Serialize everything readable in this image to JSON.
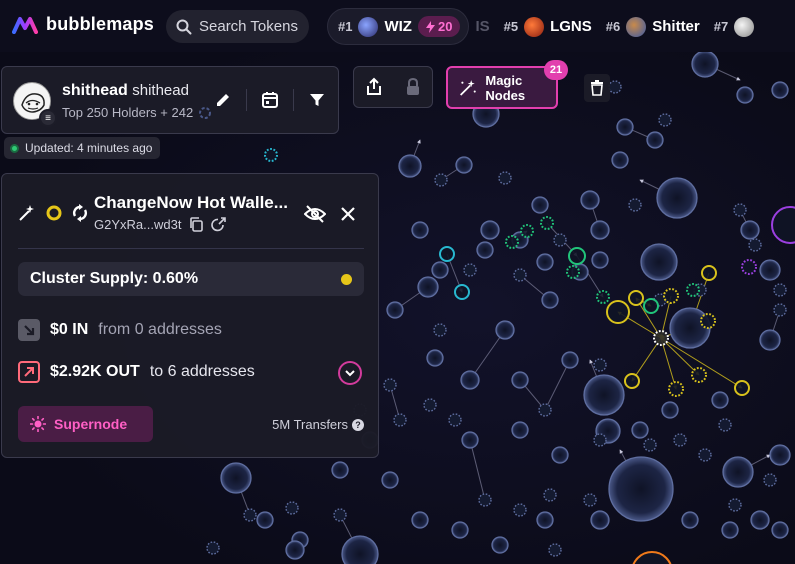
{
  "app": {
    "name": "bubblemaps"
  },
  "search": {
    "label": "Search Tokens"
  },
  "tokens": {
    "first": {
      "rank": "#1",
      "name": "WIZ",
      "badge": "20"
    },
    "fade_text": "IS",
    "items": [
      {
        "rank": "#5",
        "name": "LGNS"
      },
      {
        "rank": "#6",
        "name": "Shitter"
      },
      {
        "rank": "#7",
        "name": ""
      }
    ]
  },
  "wallet": {
    "name": "shithead",
    "name_secondary": "shithead",
    "subtitle": "Top 250 Holders + 242"
  },
  "status": {
    "updated": "Updated: 4 minutes ago"
  },
  "magic_nodes": {
    "label": "Magic Nodes",
    "count": "21"
  },
  "detail": {
    "title": "ChangeNow Hot Walle...",
    "address": "G2YxRa...wd3t",
    "cluster_supply": "Cluster Supply: 0.60%",
    "in": {
      "amount": "$0 IN",
      "desc": "from 0 addresses"
    },
    "out": {
      "amount": "$2.92K OUT",
      "desc": "to 6 addresses"
    },
    "supernode_label": "Supernode",
    "transfers": "5M Transfers"
  },
  "colors": {
    "accent_pink": "#e23fae",
    "bubble_default": "#1c2340",
    "bubble_yellow": "#d9c21c",
    "bubble_green": "#21c47a",
    "bubble_cyan": "#28b8d0",
    "bubble_purple": "#9b3fe0",
    "bubble_orange": "#f07a1a"
  }
}
